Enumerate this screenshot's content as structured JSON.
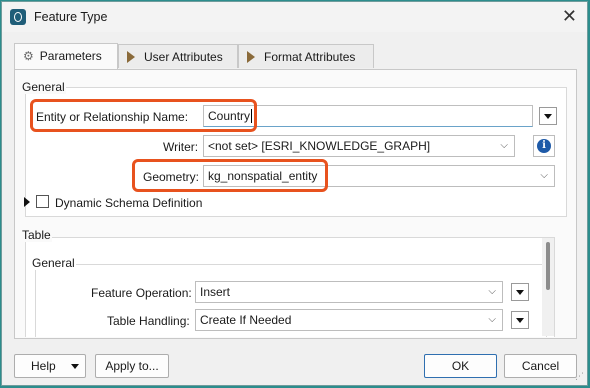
{
  "window": {
    "title": "Feature Type"
  },
  "tabs": [
    {
      "label": "Parameters",
      "icon": "gear-icon"
    },
    {
      "label": "User Attributes",
      "icon": "arrow-icon"
    },
    {
      "label": "Format Attributes",
      "icon": "arrow-icon"
    }
  ],
  "general": {
    "title": "General",
    "entity_label": "Entity or Relationship Name:",
    "entity_value": "Country",
    "writer_label": "Writer:",
    "writer_value": "<not set> [ESRI_KNOWLEDGE_GRAPH]",
    "geometry_label": "Geometry:",
    "geometry_value": "kg_nonspatial_entity",
    "dynamic_schema_label": "Dynamic Schema Definition",
    "dynamic_schema_checked": false
  },
  "table": {
    "title": "Table",
    "general_title": "General",
    "feature_operation_label": "Feature Operation:",
    "feature_operation_value": "Insert",
    "table_handling_label": "Table Handling:",
    "table_handling_value": "Create If Needed"
  },
  "footer": {
    "help_label": "Help",
    "apply_label": "Apply to...",
    "ok_label": "OK",
    "cancel_label": "Cancel"
  },
  "colors": {
    "highlight": "#e8521e",
    "accent": "#2f6fb0"
  }
}
